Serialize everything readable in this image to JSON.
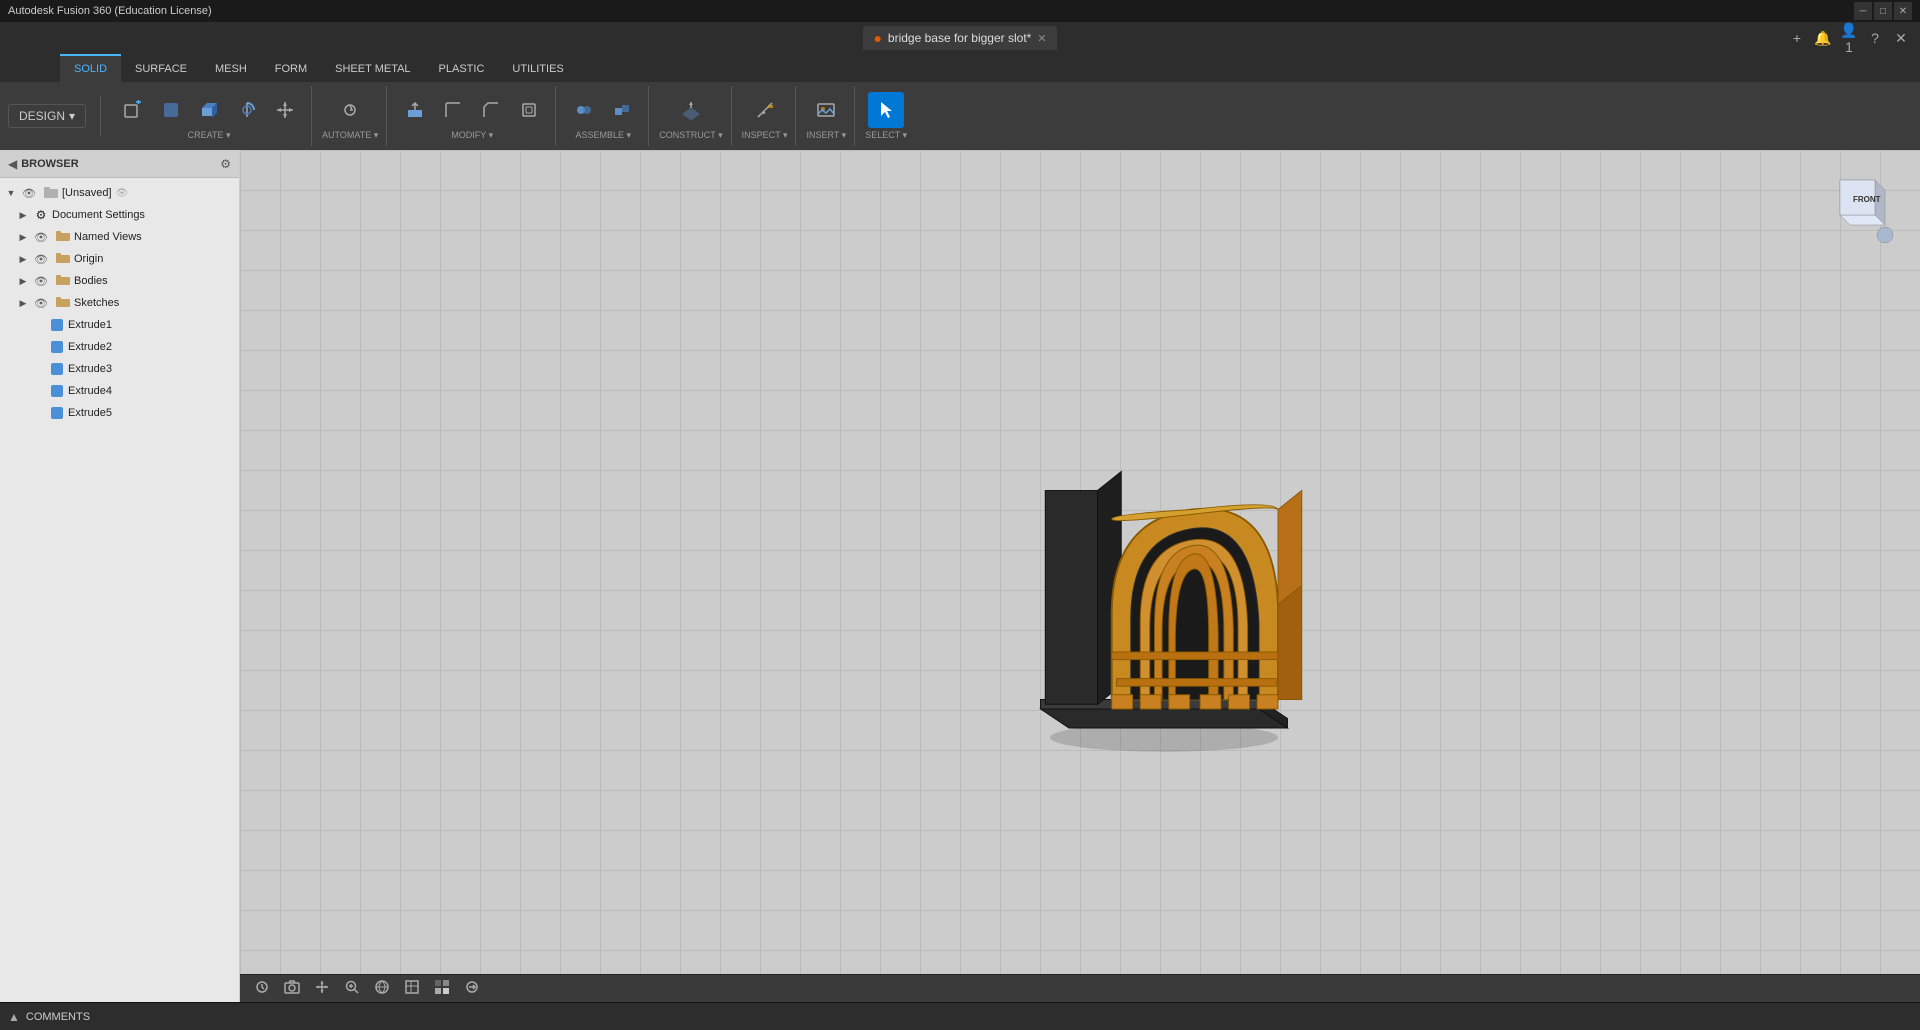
{
  "titlebar": {
    "app_name": "Autodesk Fusion 360 (Education License)",
    "min_btn": "─",
    "max_btn": "□",
    "close_btn": "✕"
  },
  "doc_tab": {
    "title": "bridge base for bigger slot*",
    "icon": "●",
    "close": "✕"
  },
  "doc_actions": {
    "add": "+",
    "notifications": "🔔",
    "profile": "👤",
    "help": "?",
    "close": "✕"
  },
  "toolbar": {
    "tabs": [
      {
        "id": "solid",
        "label": "SOLID",
        "active": true
      },
      {
        "id": "surface",
        "label": "SURFACE",
        "active": false
      },
      {
        "id": "mesh",
        "label": "MESH",
        "active": false
      },
      {
        "id": "form",
        "label": "FORM",
        "active": false
      },
      {
        "id": "sheet_metal",
        "label": "SHEET METAL",
        "active": false
      },
      {
        "id": "plastic",
        "label": "PLASTIC",
        "active": false
      },
      {
        "id": "utilities",
        "label": "UTILITIES",
        "active": false
      }
    ],
    "design_label": "DESIGN",
    "groups": [
      {
        "id": "create",
        "label": "CREATE ▾",
        "icons": [
          "create1",
          "create2",
          "create3",
          "create4",
          "create5"
        ]
      },
      {
        "id": "automate",
        "label": "AUTOMATE ▾",
        "icons": [
          "automate1"
        ]
      },
      {
        "id": "modify",
        "label": "MODIFY ▾",
        "icons": [
          "modify1",
          "modify2",
          "modify3",
          "modify4"
        ]
      },
      {
        "id": "assemble",
        "label": "ASSEMBLE ▾",
        "icons": [
          "assemble1",
          "assemble2"
        ]
      },
      {
        "id": "construct",
        "label": "CONSTRUCT ▾",
        "icons": [
          "construct1"
        ]
      },
      {
        "id": "inspect",
        "label": "INSPECT ▾",
        "icons": [
          "inspect1"
        ]
      },
      {
        "id": "insert",
        "label": "INSERT ▾",
        "icons": [
          "insert1"
        ]
      },
      {
        "id": "select",
        "label": "SELECT ▾",
        "icons": [
          "select1"
        ],
        "active": true
      }
    ]
  },
  "browser": {
    "title": "BROWSER",
    "root": {
      "label": "[Unsaved]",
      "items": [
        {
          "id": "doc_settings",
          "label": "Document Settings",
          "indent": 1,
          "has_arrow": true,
          "has_gear": true
        },
        {
          "id": "named_views",
          "label": "Named Views",
          "indent": 1,
          "has_arrow": true
        },
        {
          "id": "origin",
          "label": "Origin",
          "indent": 1,
          "has_arrow": true
        },
        {
          "id": "bodies",
          "label": "Bodies",
          "indent": 1,
          "has_arrow": true
        },
        {
          "id": "sketches",
          "label": "Sketches",
          "indent": 1,
          "has_arrow": true,
          "expanded": false
        },
        {
          "id": "extrude1",
          "label": "Extrude1",
          "indent": 2
        },
        {
          "id": "extrude2",
          "label": "Extrude2",
          "indent": 2
        },
        {
          "id": "extrude3",
          "label": "Extrude3",
          "indent": 2
        },
        {
          "id": "extrude4",
          "label": "Extrude4",
          "indent": 2
        },
        {
          "id": "extrude5",
          "label": "Extrude5",
          "indent": 2
        }
      ]
    }
  },
  "view_cube": {
    "face": "FRONT"
  },
  "bottom_tools": [
    "⚙",
    "📷",
    "✋",
    "🔍",
    "🔵",
    "⬜",
    "▦",
    "⚙"
  ],
  "status_bar": {
    "comments_label": "COMMENTS",
    "expand_icon": "▲"
  }
}
